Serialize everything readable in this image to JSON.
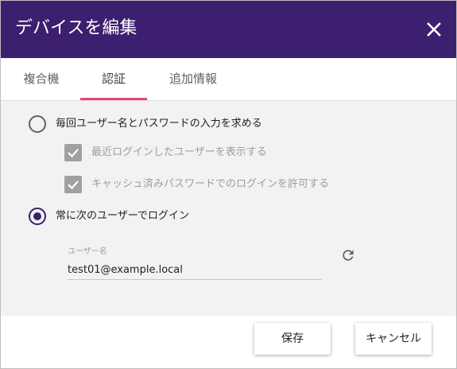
{
  "dialog": {
    "title": "デバイスを編集",
    "close_icon": "close-icon"
  },
  "tabs": [
    {
      "label": "複合機",
      "active": false
    },
    {
      "label": "認証",
      "active": true
    },
    {
      "label": "追加情報",
      "active": false
    }
  ],
  "auth": {
    "option_prompt": {
      "label": "毎回ユーザー名とパスワードの入力を求める",
      "selected": false
    },
    "sub_options": [
      {
        "label": "最近ログインしたユーザーを表示する",
        "checked": true,
        "disabled": true
      },
      {
        "label": "キャッシュ済みパスワードでのログインを許可する",
        "checked": true,
        "disabled": true
      }
    ],
    "option_fixed": {
      "label": "常に次のユーザーでログイン",
      "selected": true
    },
    "username": {
      "label": "ユーザー名",
      "value": "test01@example.local"
    },
    "refresh_icon": "refresh-icon"
  },
  "footer": {
    "save_label": "保存",
    "cancel_label": "キャンセル"
  },
  "colors": {
    "header": "#3c1f6e",
    "tab_indicator": "#e5457a",
    "radio_selected": "#3c1f6e"
  }
}
